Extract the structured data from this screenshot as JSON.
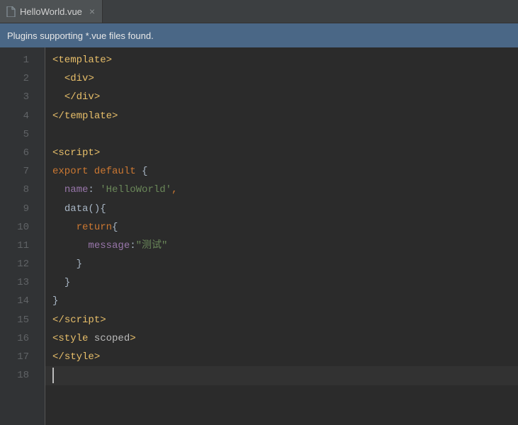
{
  "tab": {
    "filename": "HelloWorld.vue",
    "close_glyph": "×"
  },
  "notification": {
    "message": "Plugins supporting *.vue files found."
  },
  "line_numbers": [
    "1",
    "2",
    "3",
    "4",
    "5",
    "6",
    "7",
    "8",
    "9",
    "10",
    "11",
    "12",
    "13",
    "14",
    "15",
    "16",
    "17",
    "18"
  ],
  "code": {
    "l1": {
      "a": "<",
      "b": "template",
      "c": ">"
    },
    "l2": {
      "indent": "  ",
      "a": "<",
      "b": "div",
      "c": ">"
    },
    "l3": {
      "indent": "  ",
      "a": "</",
      "b": "div",
      "c": ">"
    },
    "l4": {
      "a": "</",
      "b": "template",
      "c": ">"
    },
    "l5": "",
    "l6": {
      "a": "<",
      "b": "script",
      "c": ">"
    },
    "l7": {
      "a": "export default ",
      "b": "{"
    },
    "l8": {
      "indent": "  ",
      "a": "name",
      "b": ": ",
      "c": "'HelloWorld'",
      "d": ","
    },
    "l9": {
      "indent": "  ",
      "a": "data",
      "b": "(){"
    },
    "l10": {
      "indent": "    ",
      "a": "return",
      "b": "{"
    },
    "l11": {
      "indent": "      ",
      "a": "message",
      "b": ":",
      "c": "\"测试\""
    },
    "l12": {
      "indent": "    ",
      "a": "}"
    },
    "l13": {
      "indent": "  ",
      "a": "}"
    },
    "l14": {
      "a": "}"
    },
    "l15": {
      "a": "</",
      "b": "script",
      "c": ">"
    },
    "l16": {
      "a": "<",
      "b": "style ",
      "attr": "scoped",
      "c": ">"
    },
    "l17": {
      "a": "</",
      "b": "style",
      "c": ">"
    },
    "l18": ""
  }
}
